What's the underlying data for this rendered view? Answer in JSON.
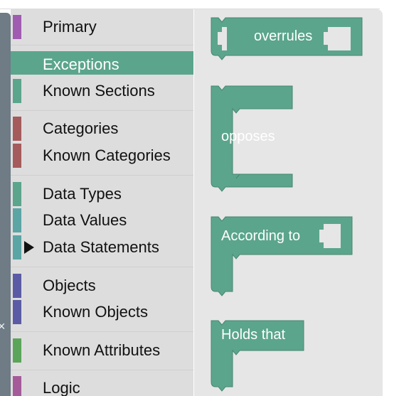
{
  "toolbox": {
    "categories": [
      {
        "label": "Primary",
        "color": "#a05cb0",
        "selected": false,
        "expandable": false
      },
      {
        "label": "Exceptions",
        "color": "#5ba58c",
        "selected": true,
        "expandable": false
      },
      {
        "label": "Known Sections",
        "color": "#5ba58c",
        "selected": false,
        "expandable": false
      },
      {
        "label": "Categories",
        "color": "#a55b5b",
        "selected": false,
        "expandable": false
      },
      {
        "label": "Known Categories",
        "color": "#a55b5b",
        "selected": false,
        "expandable": false
      },
      {
        "label": "Data Types",
        "color": "#5ba58c",
        "selected": false,
        "expandable": false
      },
      {
        "label": "Data Values",
        "color": "#5ba5a5",
        "selected": false,
        "expandable": false
      },
      {
        "label": "Data Statements",
        "color": "#5ba5a5",
        "selected": false,
        "expandable": true
      },
      {
        "label": "Objects",
        "color": "#5b5ba5",
        "selected": false,
        "expandable": false
      },
      {
        "label": "Known Objects",
        "color": "#5b5ba5",
        "selected": false,
        "expandable": false
      },
      {
        "label": "Known Attributes",
        "color": "#5ba55b",
        "selected": false,
        "expandable": false
      },
      {
        "label": "Logic",
        "color": "#a55b99",
        "selected": false,
        "expandable": false
      }
    ]
  },
  "workspace": {
    "block_color": "#5ba58c",
    "blocks": [
      {
        "label": "overrules"
      },
      {
        "label": "opposes"
      },
      {
        "label": "According to"
      },
      {
        "label": "Holds that"
      }
    ]
  }
}
